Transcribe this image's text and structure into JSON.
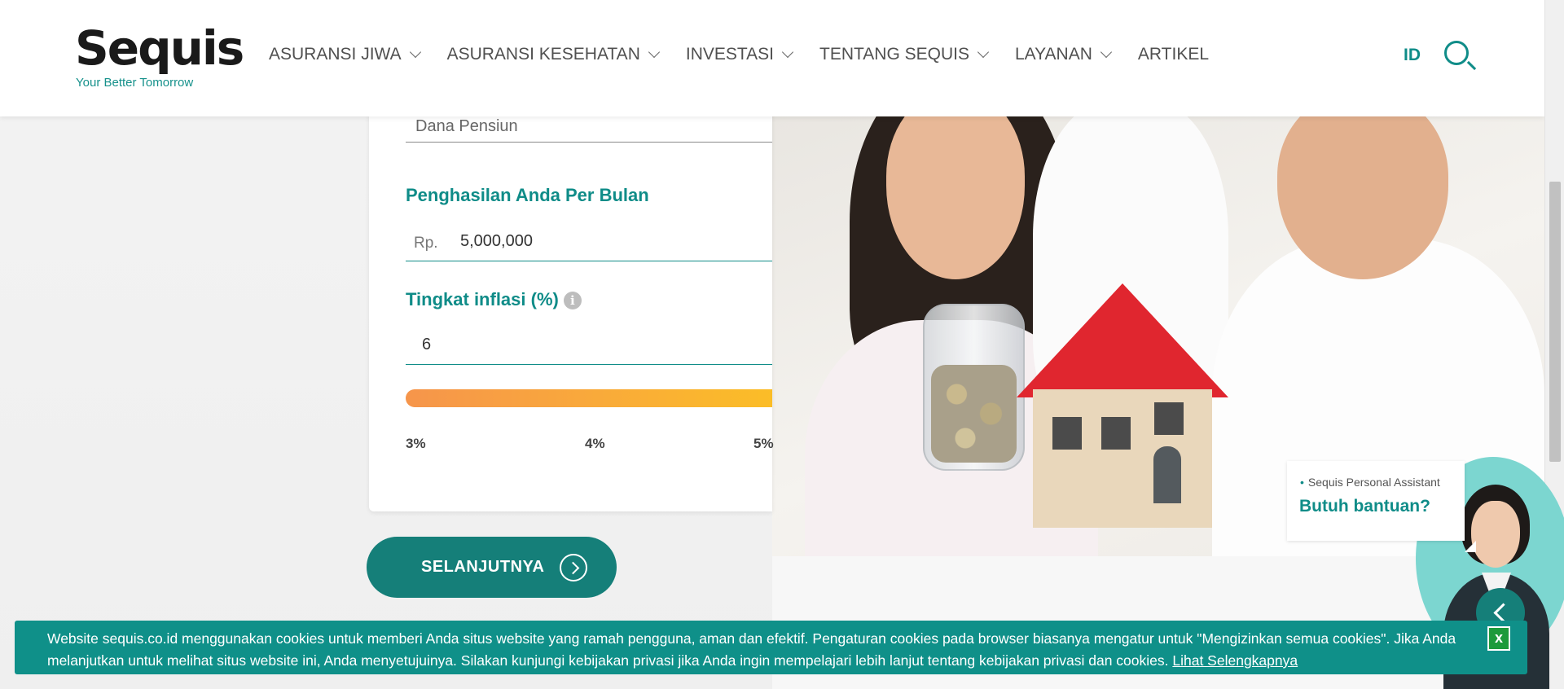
{
  "header": {
    "logo_text": "Sequis",
    "logo_tagline": "Your Better Tomorrow",
    "nav": [
      {
        "label": "ASURANSI JIWA",
        "has_dropdown": true
      },
      {
        "label": "ASURANSI KESEHATAN",
        "has_dropdown": true
      },
      {
        "label": "INVESTASI",
        "has_dropdown": true
      },
      {
        "label": "TENTANG SEQUIS",
        "has_dropdown": true
      },
      {
        "label": "LAYANAN",
        "has_dropdown": true
      },
      {
        "label": "ARTIKEL",
        "has_dropdown": false
      }
    ],
    "language": "ID",
    "search_icon": "search-icon"
  },
  "form": {
    "goal_value": "Dana Pensiun",
    "income_label": "Penghasilan Anda Per Bulan",
    "income_currency": "Rp.",
    "income_value": "5,000,000",
    "inflation_label": "Tingkat inflasi (%)",
    "inflation_info_icon": "i",
    "inflation_value": "6",
    "slider_ticks": [
      "3%",
      "4%",
      "5%"
    ],
    "next_button": "SELANJUTNYA"
  },
  "assistant": {
    "subtitle": "Sequis Personal Assistant",
    "title": "Butuh bantuan?"
  },
  "cookie": {
    "text": "Website sequis.co.id menggunakan cookies untuk memberi Anda situs website yang ramah pengguna, aman dan efektif. Pengaturan cookies pada browser biasanya mengatur untuk \"Mengizinkan semua cookies\". Jika Anda melanjutkan untuk melihat situs website ini, Anda menyetujuinya. Silakan kunjungi kebijakan privasi jika Anda ingin mempelajari lebih lanjut tentang kebijakan privasi dan cookies.",
    "link_text": "Lihat Selengkapnya",
    "close_label": "x"
  },
  "colors": {
    "brand": "#0f8c88",
    "button": "#157f79",
    "cookie_bg": "#0f9089",
    "slider_start": "#f6954b",
    "slider_end": "#fbbd27"
  }
}
